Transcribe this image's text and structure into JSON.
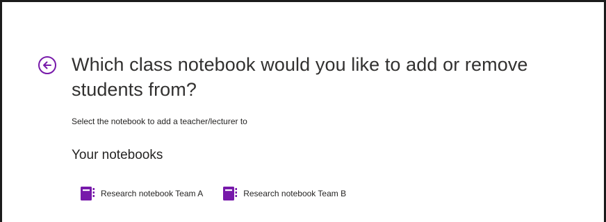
{
  "dialog": {
    "title": "Which class notebook would you like to add or remove students from?",
    "subtitle": "Select the notebook to add a teacher/lecturer to",
    "section_heading": "Your notebooks"
  },
  "notebooks": [
    {
      "label": "Research notebook  Team A",
      "icon": "notebook-icon"
    },
    {
      "label": "Research notebook  Team B",
      "icon": "notebook-icon"
    }
  ],
  "colors": {
    "accent": "#7719aa"
  }
}
